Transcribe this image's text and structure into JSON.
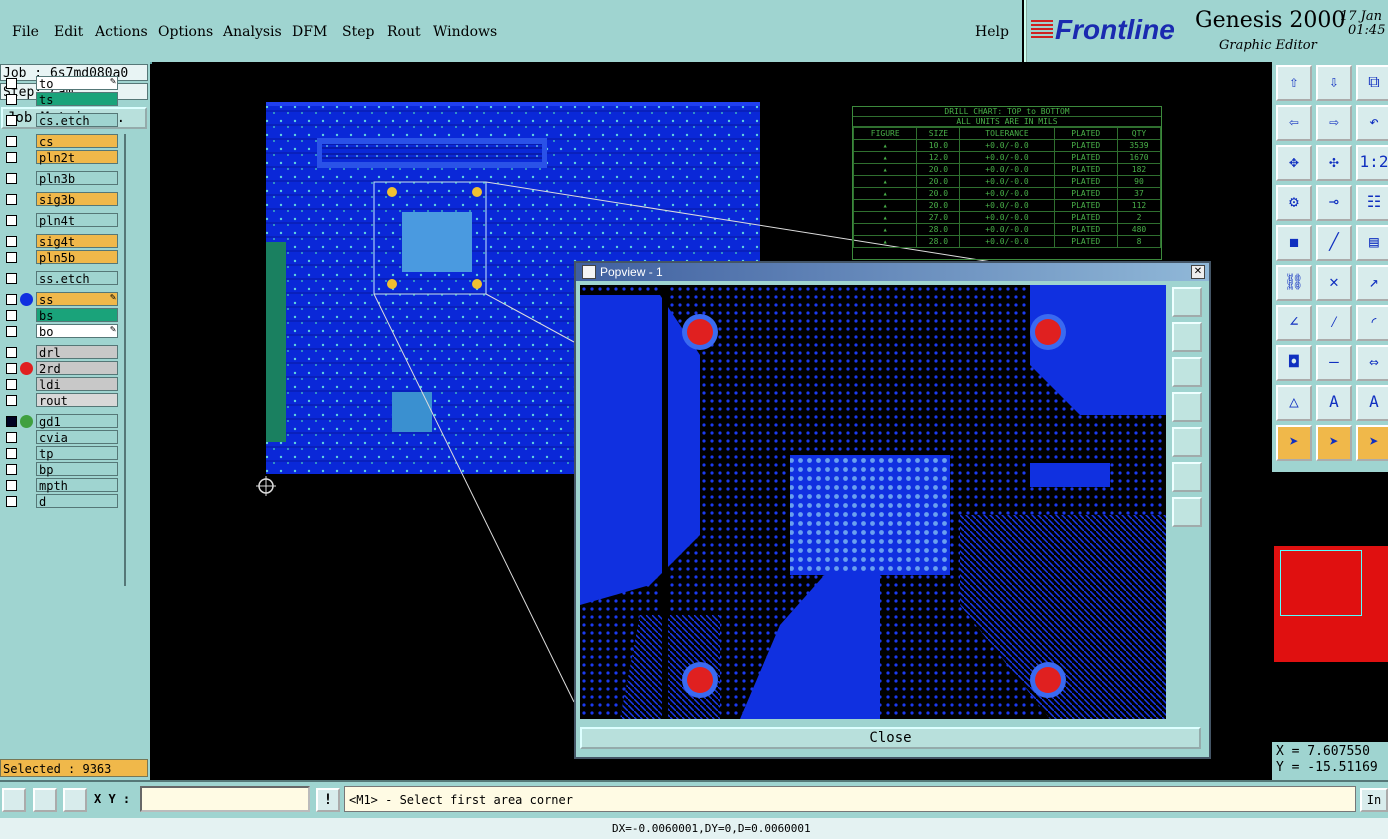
{
  "menubar": {
    "items": [
      "File",
      "Edit",
      "Actions",
      "Options",
      "Analysis",
      "DFM",
      "Step",
      "Rout",
      "Windows"
    ],
    "help": "Help"
  },
  "brand": {
    "logo": "Frontline",
    "title": "Genesis 2000",
    "subtitle": "Graphic Editor",
    "date_line1": "17 Jan",
    "date_line2": "01:45"
  },
  "job": {
    "job_label": "Job : 6s7md080a0",
    "step_label": "Step: cam",
    "matrix_button": "Job Matrix ..."
  },
  "layers": [
    {
      "name": "to",
      "color": "#ffffff",
      "checked": false,
      "edit": true
    },
    {
      "name": "ts",
      "color": "#1aa37a",
      "checked": false
    },
    {
      "name": "cs.etch",
      "color": "#9fd4d0",
      "checked": false
    },
    {
      "name": "cs",
      "color": "#f0b84a",
      "checked": false
    },
    {
      "name": "pln2t",
      "color": "#f0b84a",
      "checked": false
    },
    {
      "name": "pln3b",
      "color": "#9fd4d0",
      "checked": false
    },
    {
      "name": "sig3b",
      "color": "#f0b84a",
      "checked": false
    },
    {
      "name": "pln4t",
      "color": "#9fd4d0",
      "checked": false
    },
    {
      "name": "sig4t",
      "color": "#f0b84a",
      "checked": false
    },
    {
      "name": "pln5b",
      "color": "#f0b84a",
      "checked": false
    },
    {
      "name": "ss.etch",
      "color": "#9fd4d0",
      "checked": false
    },
    {
      "name": "ss",
      "color": "#f0b84a",
      "checked": false,
      "dot": "#1030e0",
      "edit": true
    },
    {
      "name": "bs",
      "color": "#1aa37a",
      "checked": false
    },
    {
      "name": "bo",
      "color": "#ffffff",
      "checked": false,
      "edit": true
    },
    {
      "name": "drl",
      "color": "#c8c8c8",
      "checked": false
    },
    {
      "name": "2rd",
      "color": "#c8c8c8",
      "checked": false,
      "dot": "#e02020"
    },
    {
      "name": "ldi",
      "color": "#c8c8c8",
      "checked": false
    },
    {
      "name": "rout",
      "color": "#d8d8d8",
      "checked": false
    },
    {
      "name": "gd1",
      "color": "#9fd4d0",
      "checked": true,
      "dot": "#40a040"
    },
    {
      "name": "cvia",
      "color": "#9fd4d0",
      "checked": false
    },
    {
      "name": "tp",
      "color": "#9fd4d0",
      "checked": false
    },
    {
      "name": "bp",
      "color": "#9fd4d0",
      "checked": false
    },
    {
      "name": "mpth",
      "color": "#9fd4d0",
      "checked": false
    },
    {
      "name": "d",
      "color": "#9fd4d0",
      "checked": false
    }
  ],
  "selected": "Selected : 9363",
  "drill_chart": {
    "title1": "DRILL CHART: TOP to BOTTOM",
    "title2": "ALL UNITS ARE IN MILS",
    "headers": [
      "FIGURE",
      "SIZE",
      "TOLERANCE",
      "PLATED",
      "QTY"
    ],
    "rows": [
      [
        "▴",
        "10.0",
        "+0.0/-0.0",
        "PLATED",
        "3539"
      ],
      [
        "▴",
        "12.0",
        "+0.0/-0.0",
        "PLATED",
        "1670"
      ],
      [
        "▴",
        "20.0",
        "+0.0/-0.0",
        "PLATED",
        "182"
      ],
      [
        "▴",
        "20.0",
        "+0.0/-0.0",
        "PLATED",
        "90"
      ],
      [
        "▴",
        "20.0",
        "+0.0/-0.0",
        "PLATED",
        "37"
      ],
      [
        "▴",
        "20.0",
        "+0.0/-0.0",
        "PLATED",
        "112"
      ],
      [
        "▴",
        "27.0",
        "+0.0/-0.0",
        "PLATED",
        "2"
      ],
      [
        "▴",
        "28.0",
        "+0.0/-0.0",
        "PLATED",
        "480"
      ],
      [
        "▴",
        "28.0",
        "+0.0/-0.0",
        "PLATED",
        "8"
      ]
    ]
  },
  "popup": {
    "title": "Popview - 1",
    "close_label": "Close"
  },
  "coords": {
    "x": "X = 7.607550",
    "y": "Y = -15.51169"
  },
  "bottom": {
    "xy_label": "X Y :",
    "xy_value": "",
    "message": "<M1> - Select first area corner",
    "right_button": "In"
  },
  "status": "DX=-0.0060001,DY=0,D=0.0060001",
  "colors": {
    "panel": "#9fd4d0",
    "board": "#1030e0",
    "highlight": "#f0b84a",
    "pad_red": "#e02020"
  }
}
